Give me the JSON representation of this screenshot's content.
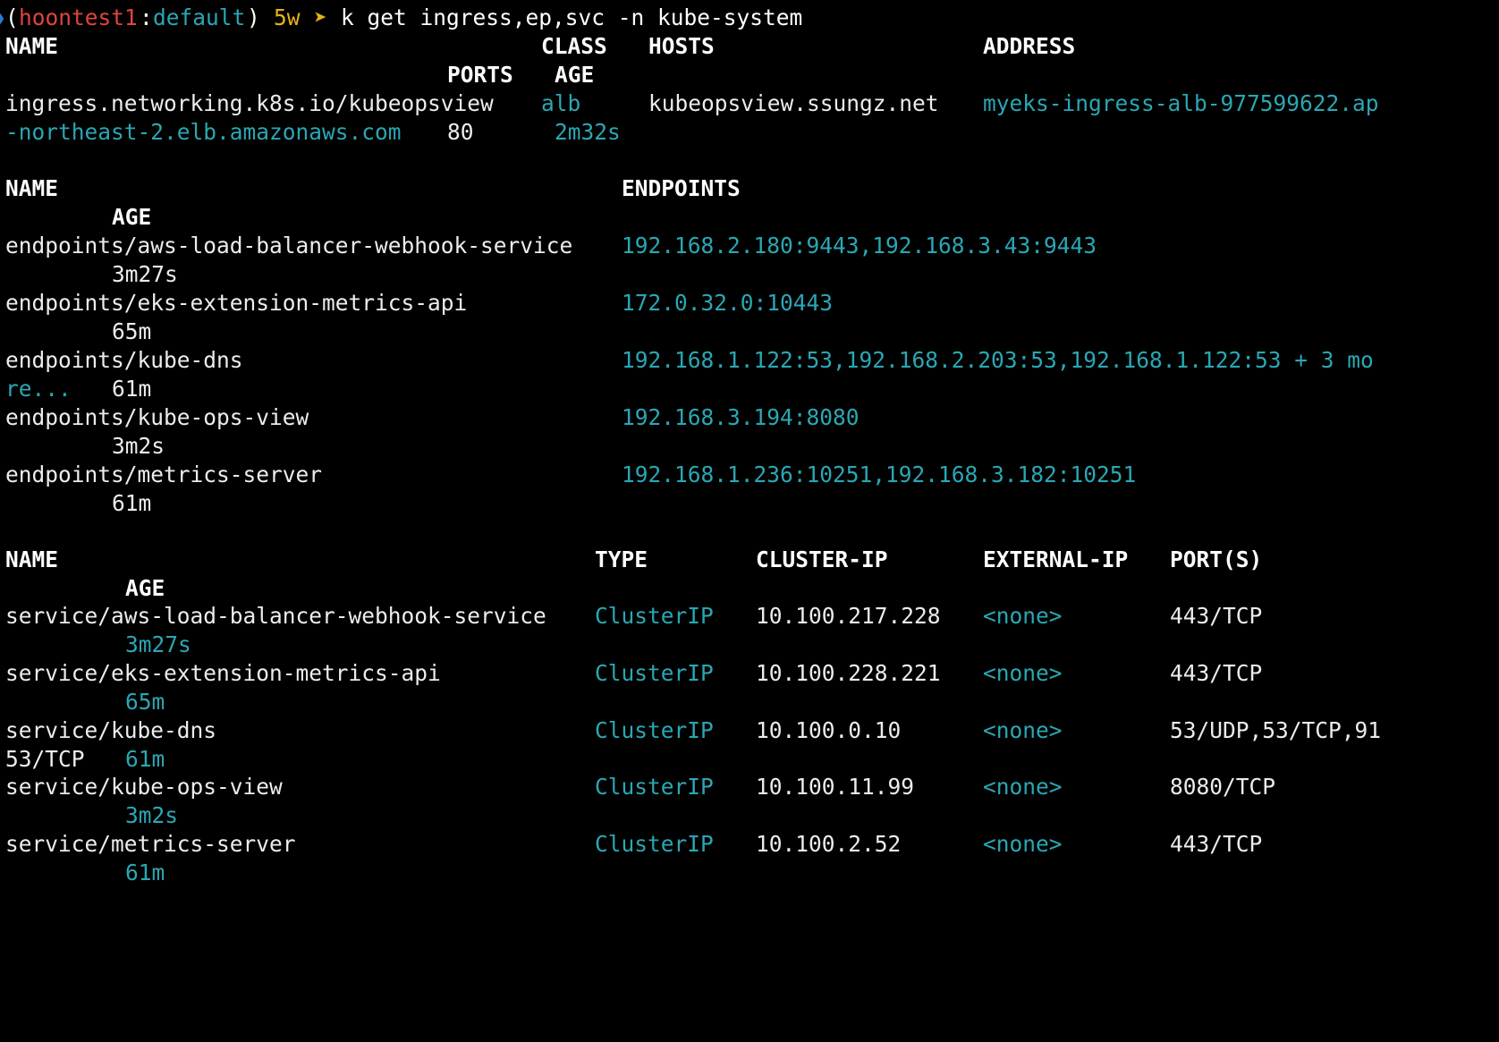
{
  "prompt": {
    "arrow": "❯",
    "open_paren": "(",
    "cluster": "hoontest1",
    "colon": ":",
    "namespace": "default",
    "close_paren": ")",
    "duration": "5w",
    "chevron": "➤",
    "command": "k get ingress,ep,svc -n kube-system"
  },
  "ingress": {
    "headers": {
      "name": "NAME",
      "class": "CLASS",
      "hosts": "HOSTS",
      "address": "ADDRESS",
      "ports": "PORTS",
      "age": "AGE"
    },
    "row": {
      "name": "ingress.networking.k8s.io/kubeopsview",
      "class": "alb",
      "hosts": "kubeopsview.ssungz.net",
      "address_part1": "myeks-ingress-alb-977599622.ap",
      "address_part2": "-northeast-2.elb.amazonaws.com",
      "ports": "80",
      "age": "2m32s"
    }
  },
  "endpoints": {
    "headers": {
      "name": "NAME",
      "endpoints": "ENDPOINTS",
      "age": "AGE"
    },
    "rows": [
      {
        "name": "endpoints/aws-load-balancer-webhook-service",
        "endpoints": "192.168.2.180:9443,192.168.3.43:9443",
        "age": "3m27s"
      },
      {
        "name": "endpoints/eks-extension-metrics-api",
        "endpoints": "172.0.32.0:10443",
        "age": "65m"
      },
      {
        "name": "endpoints/kube-dns",
        "endpoints": "192.168.1.122:53,192.168.2.203:53,192.168.1.122:53 + 3 mo",
        "endpoints_wrap": "re...",
        "age": "61m"
      },
      {
        "name": "endpoints/kube-ops-view",
        "endpoints": "192.168.3.194:8080",
        "age": "3m2s"
      },
      {
        "name": "endpoints/metrics-server",
        "endpoints": "192.168.1.236:10251,192.168.3.182:10251",
        "age": "61m"
      }
    ]
  },
  "services": {
    "headers": {
      "name": "NAME",
      "type": "TYPE",
      "cluster_ip": "CLUSTER-IP",
      "external_ip": "EXTERNAL-IP",
      "ports": "PORT(S)",
      "age": "AGE"
    },
    "rows": [
      {
        "name": "service/aws-load-balancer-webhook-service",
        "type": "ClusterIP",
        "cluster_ip": "10.100.217.228",
        "external_ip": "<none>",
        "ports": "443/TCP",
        "age": "3m27s"
      },
      {
        "name": "service/eks-extension-metrics-api",
        "type": "ClusterIP",
        "cluster_ip": "10.100.228.221",
        "external_ip": "<none>",
        "ports": "443/TCP",
        "age": "65m"
      },
      {
        "name": "service/kube-dns",
        "type": "ClusterIP",
        "cluster_ip": "10.100.0.10",
        "external_ip": "<none>",
        "ports": "53/UDP,53/TCP,91",
        "ports_wrap": "53/TCP",
        "age": "61m"
      },
      {
        "name": "service/kube-ops-view",
        "type": "ClusterIP",
        "cluster_ip": "10.100.11.99",
        "external_ip": "<none>",
        "ports": "8080/TCP",
        "age": "3m2s"
      },
      {
        "name": "service/metrics-server",
        "type": "ClusterIP",
        "cluster_ip": "10.100.2.52",
        "external_ip": "<none>",
        "ports": "443/TCP",
        "age": "61m"
      }
    ]
  },
  "colors": {
    "background": "#000000",
    "text": "#ececec",
    "cyan": "#2aa7b4",
    "red": "#e0453d",
    "yellow": "#e8b21b",
    "blue": "#2a7fd4"
  }
}
